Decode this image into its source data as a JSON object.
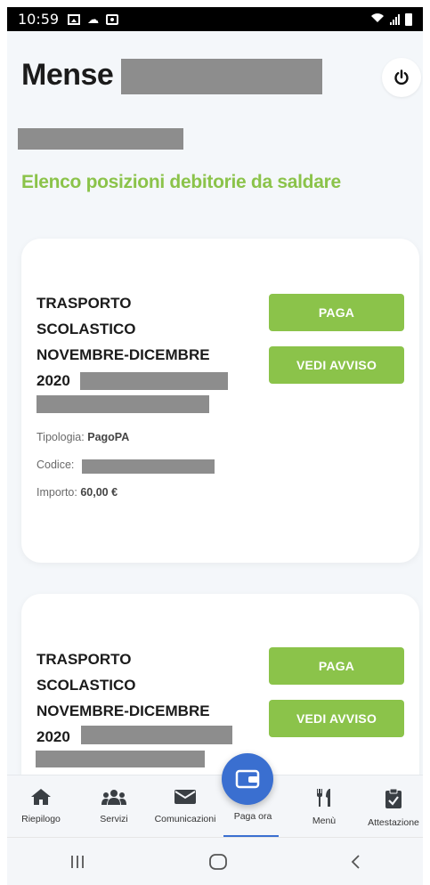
{
  "status_bar": {
    "time": "10:59"
  },
  "header": {
    "title": "Mense"
  },
  "section_title": "Elenco posizioni debitorie da saldare",
  "cards": [
    {
      "title": "TRASPORTO SCOLASTICO NOVEMBRE-DICEMBRE 2020",
      "tipologia_label": "Tipologia:",
      "tipologia_value": "PagoPA",
      "codice_label": "Codice:",
      "importo_label": "Importo:",
      "importo_value": "60,00 €",
      "pay_label": "PAGA",
      "view_label": "VEDI AVVISO"
    },
    {
      "title": "TRASPORTO SCOLASTICO NOVEMBRE-DICEMBRE 2020",
      "pay_label": "PAGA",
      "view_label": "VEDI AVVISO"
    }
  ],
  "bottom_nav": {
    "items": [
      {
        "label": "Riepilogo",
        "icon": "home-icon"
      },
      {
        "label": "Servizi",
        "icon": "group-icon"
      },
      {
        "label": "Comunicazioni",
        "icon": "mail-icon"
      },
      {
        "label": "Paga ora",
        "icon": "wallet-icon"
      },
      {
        "label": "Menù",
        "icon": "cutlery-icon"
      },
      {
        "label": "Attestazione",
        "icon": "clipboard-check-icon"
      }
    ],
    "active_index": 3
  },
  "colors": {
    "accent_green": "#8bc34a",
    "fab_blue": "#3a6fd0",
    "background": "#f4f7fa"
  }
}
